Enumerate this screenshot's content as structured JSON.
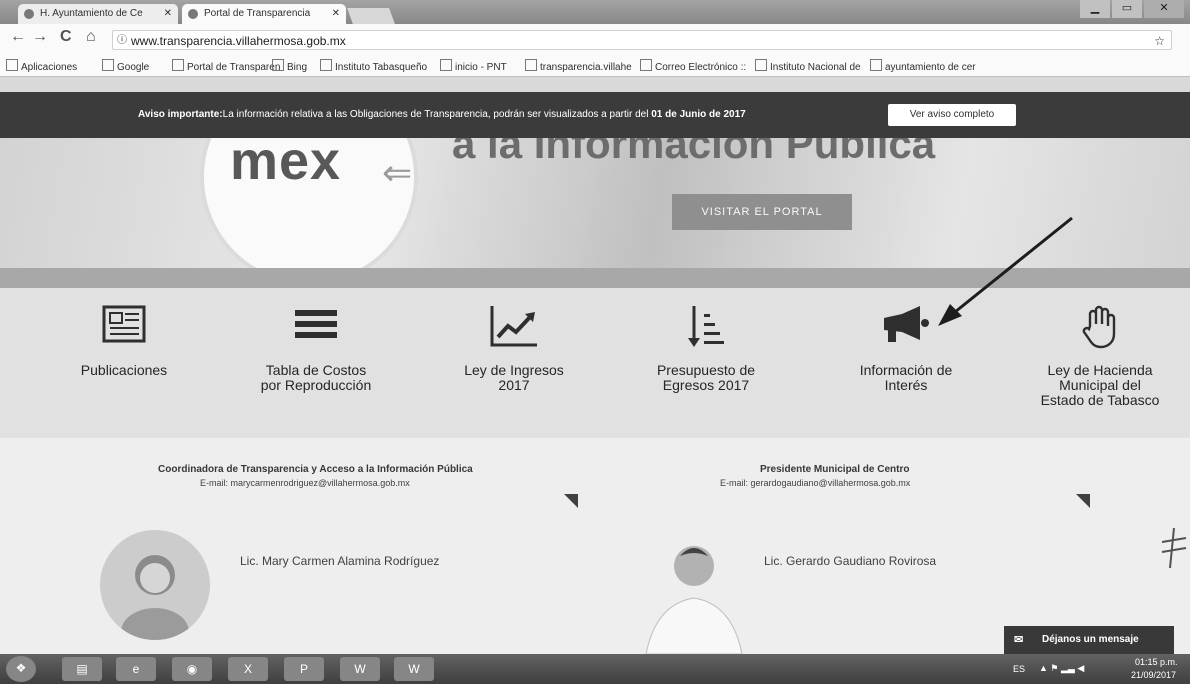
{
  "browser": {
    "tabs": [
      {
        "label": "H. Ayuntamiento de Ce"
      },
      {
        "label": "Portal de Transparencia"
      }
    ],
    "url": "www.transparencia.villahermosa.gob.mx",
    "bookmarks": [
      "Aplicaciones",
      "Google",
      "Portal de Transparen",
      "Bing",
      "Instituto Tabasqueño",
      "inicio - PNT",
      "transparencia.villahe",
      "Correo Electrónico ::",
      "Instituto Nacional de",
      "ayuntamiento de cer"
    ]
  },
  "notice": {
    "bold": "Aviso importante:",
    "text": "La información relativa a las Obligaciones de Transparencia, podrán ser visualizados a partir del ",
    "date": "01 de Junio de 2017",
    "button": "Ver aviso completo"
  },
  "hero": {
    "logo_text": "mex",
    "title": "a la Información Pública",
    "button": "VISITAR EL PORTAL"
  },
  "icon_items": [
    {
      "line1": "Publicaciones",
      "line2": "",
      "line3": "",
      "icon": "newspaper-icon"
    },
    {
      "line1": "Tabla de Costos",
      "line2": "por Reproducción",
      "line3": "",
      "icon": "list-icon"
    },
    {
      "line1": "Ley de Ingresos",
      "line2": "2017",
      "line3": "",
      "icon": "trend-chart-icon"
    },
    {
      "line1": "Presupuesto de",
      "line2": "Egresos 2017",
      "line3": "",
      "icon": "sort-descending-icon"
    },
    {
      "line1": "Información de",
      "line2": "Interés",
      "line3": "",
      "icon": "megaphone-icon"
    },
    {
      "line1": "Ley de Hacienda",
      "line2": "Municipal del",
      "line3": "Estado de Tabasco",
      "icon": "hand-icon"
    }
  ],
  "contacts": [
    {
      "title": "Coordinadora de Transparencia y Acceso a la Información Pública",
      "email": "E-mail: marycarmenrodriguez@villahermosa.gob.mx",
      "name": "Lic. Mary Carmen Alamina Rodríguez"
    },
    {
      "title": "Presidente Municipal de Centro",
      "email": "E-mail: gerardogaudiano@villahermosa.gob.mx",
      "name": "Lic. Gerardo Gaudiano Rovirosa"
    }
  ],
  "chat": {
    "label": "Déjanos un mensaje"
  },
  "tray": {
    "lang": "ES",
    "time": "01:15 p.m.",
    "date": "21/09/2017"
  }
}
